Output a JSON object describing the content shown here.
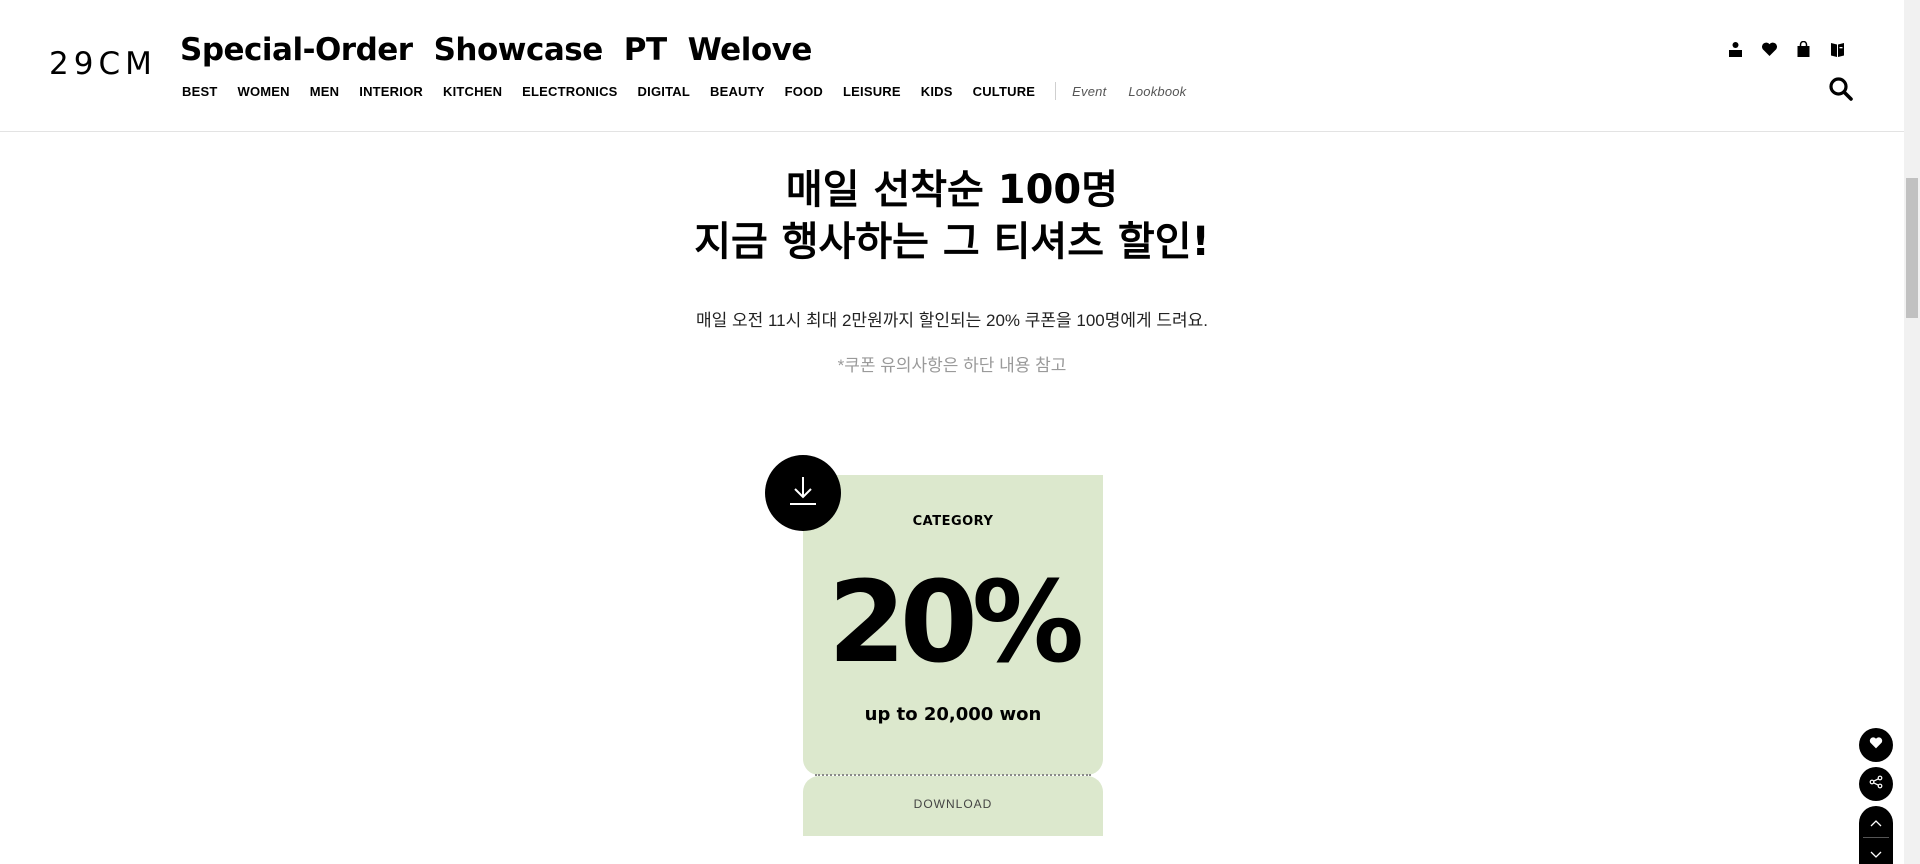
{
  "header": {
    "logo": "29CM",
    "special_nav": [
      "Special-Order",
      "Showcase",
      "PT",
      "Welove"
    ],
    "category_nav": [
      "BEST",
      "WOMEN",
      "MEN",
      "INTERIOR",
      "KITCHEN",
      "ELECTRONICS",
      "DIGITAL",
      "BEAUTY",
      "FOOD",
      "LEISURE",
      "KIDS",
      "CULTURE"
    ],
    "extra_nav": [
      "Event",
      "Lookbook"
    ],
    "icons": [
      "user-icon",
      "heart-icon",
      "bag-icon",
      "book-icon",
      "search-icon"
    ]
  },
  "main": {
    "headline_line1": "매일 선착순 100명",
    "headline_line2": "지금 행사하는 그 티셔츠 할인!",
    "subline": "매일 오전 11시 최대 2만원까지 할인되는 20% 쿠폰을 100명에게 드려요.",
    "note": "*쿠폰 유의사항은 하단 내용 참고"
  },
  "coupon": {
    "label": "CATEGORY",
    "value": "20%",
    "limit": "up to 20,000 won",
    "action": "DOWNLOAD",
    "bg_color": "#dce8cd"
  },
  "floating": [
    "heart-icon",
    "share-icon",
    "chevron-up-icon",
    "chevron-down-icon"
  ]
}
